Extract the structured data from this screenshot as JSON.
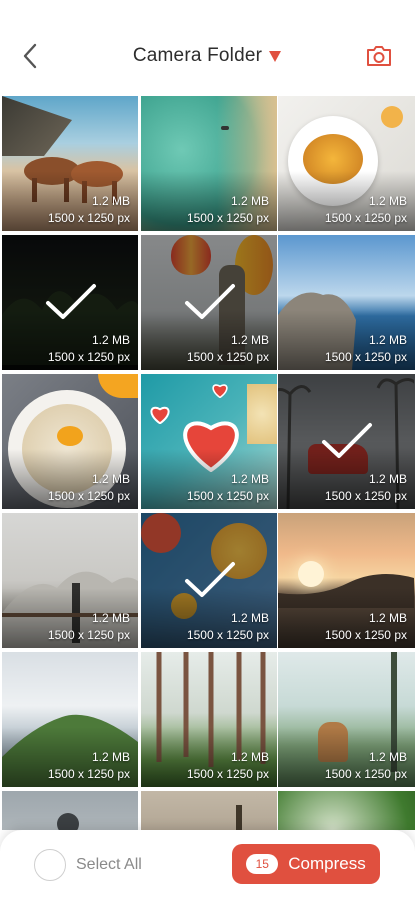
{
  "header": {
    "title": "Camera Folder",
    "accent": "#e0503f",
    "icons": {
      "back": "chevron-left-icon",
      "dropdown": "caret-down-icon",
      "camera": "camera-icon"
    }
  },
  "grid": {
    "tiles": [
      {
        "size": "1.2 MB",
        "dims": "1500 x 1250 px",
        "selected": false,
        "scene": "horses"
      },
      {
        "size": "1.2 MB",
        "dims": "1500 x 1250 px",
        "selected": false,
        "scene": "beach"
      },
      {
        "size": "1.2 MB",
        "dims": "1500 x 1250 px",
        "selected": false,
        "scene": "pancakes"
      },
      {
        "size": "1.2 MB",
        "dims": "1500 x 1250 px",
        "selected": true,
        "scene": "night-trees"
      },
      {
        "size": "1.2 MB",
        "dims": "1500 x 1250 px",
        "selected": true,
        "scene": "balloons"
      },
      {
        "size": "1.2 MB",
        "dims": "1500 x 1250 px",
        "selected": false,
        "scene": "sea-rock"
      },
      {
        "size": "1.2 MB",
        "dims": "1500 x 1250 px",
        "selected": false,
        "scene": "porridge"
      },
      {
        "size": "1.2 MB",
        "dims": "1500 x 1250 px",
        "selected": false,
        "scene": "hearts"
      },
      {
        "size": "1.2 MB",
        "dims": "1500 x 1250 px",
        "selected": true,
        "scene": "red-car"
      },
      {
        "size": "1.2 MB",
        "dims": "1500 x 1250 px",
        "selected": false,
        "scene": "mountain-birds"
      },
      {
        "size": "1.2 MB",
        "dims": "1500 x 1250 px",
        "selected": true,
        "scene": "food-table"
      },
      {
        "size": "1.2 MB",
        "dims": "1500 x 1250 px",
        "selected": false,
        "scene": "sunset-lake"
      },
      {
        "size": "1.2 MB",
        "dims": "1500 x 1250 px",
        "selected": false,
        "scene": "green-hill"
      },
      {
        "size": "1.2 MB",
        "dims": "1500 x 1250 px",
        "selected": false,
        "scene": "forest"
      },
      {
        "size": "1.2 MB",
        "dims": "1500 x 1250 px",
        "selected": false,
        "scene": "palm-woman"
      },
      {
        "size": "",
        "dims": "",
        "selected": false,
        "scene": "partial-sky"
      },
      {
        "size": "",
        "dims": "",
        "selected": false,
        "scene": "partial-trees"
      },
      {
        "size": "",
        "dims": "",
        "selected": false,
        "scene": "partial-leaves"
      }
    ]
  },
  "bottom_bar": {
    "select_all_label": "Select All",
    "compress_label": "Compress",
    "selected_count": "15"
  }
}
